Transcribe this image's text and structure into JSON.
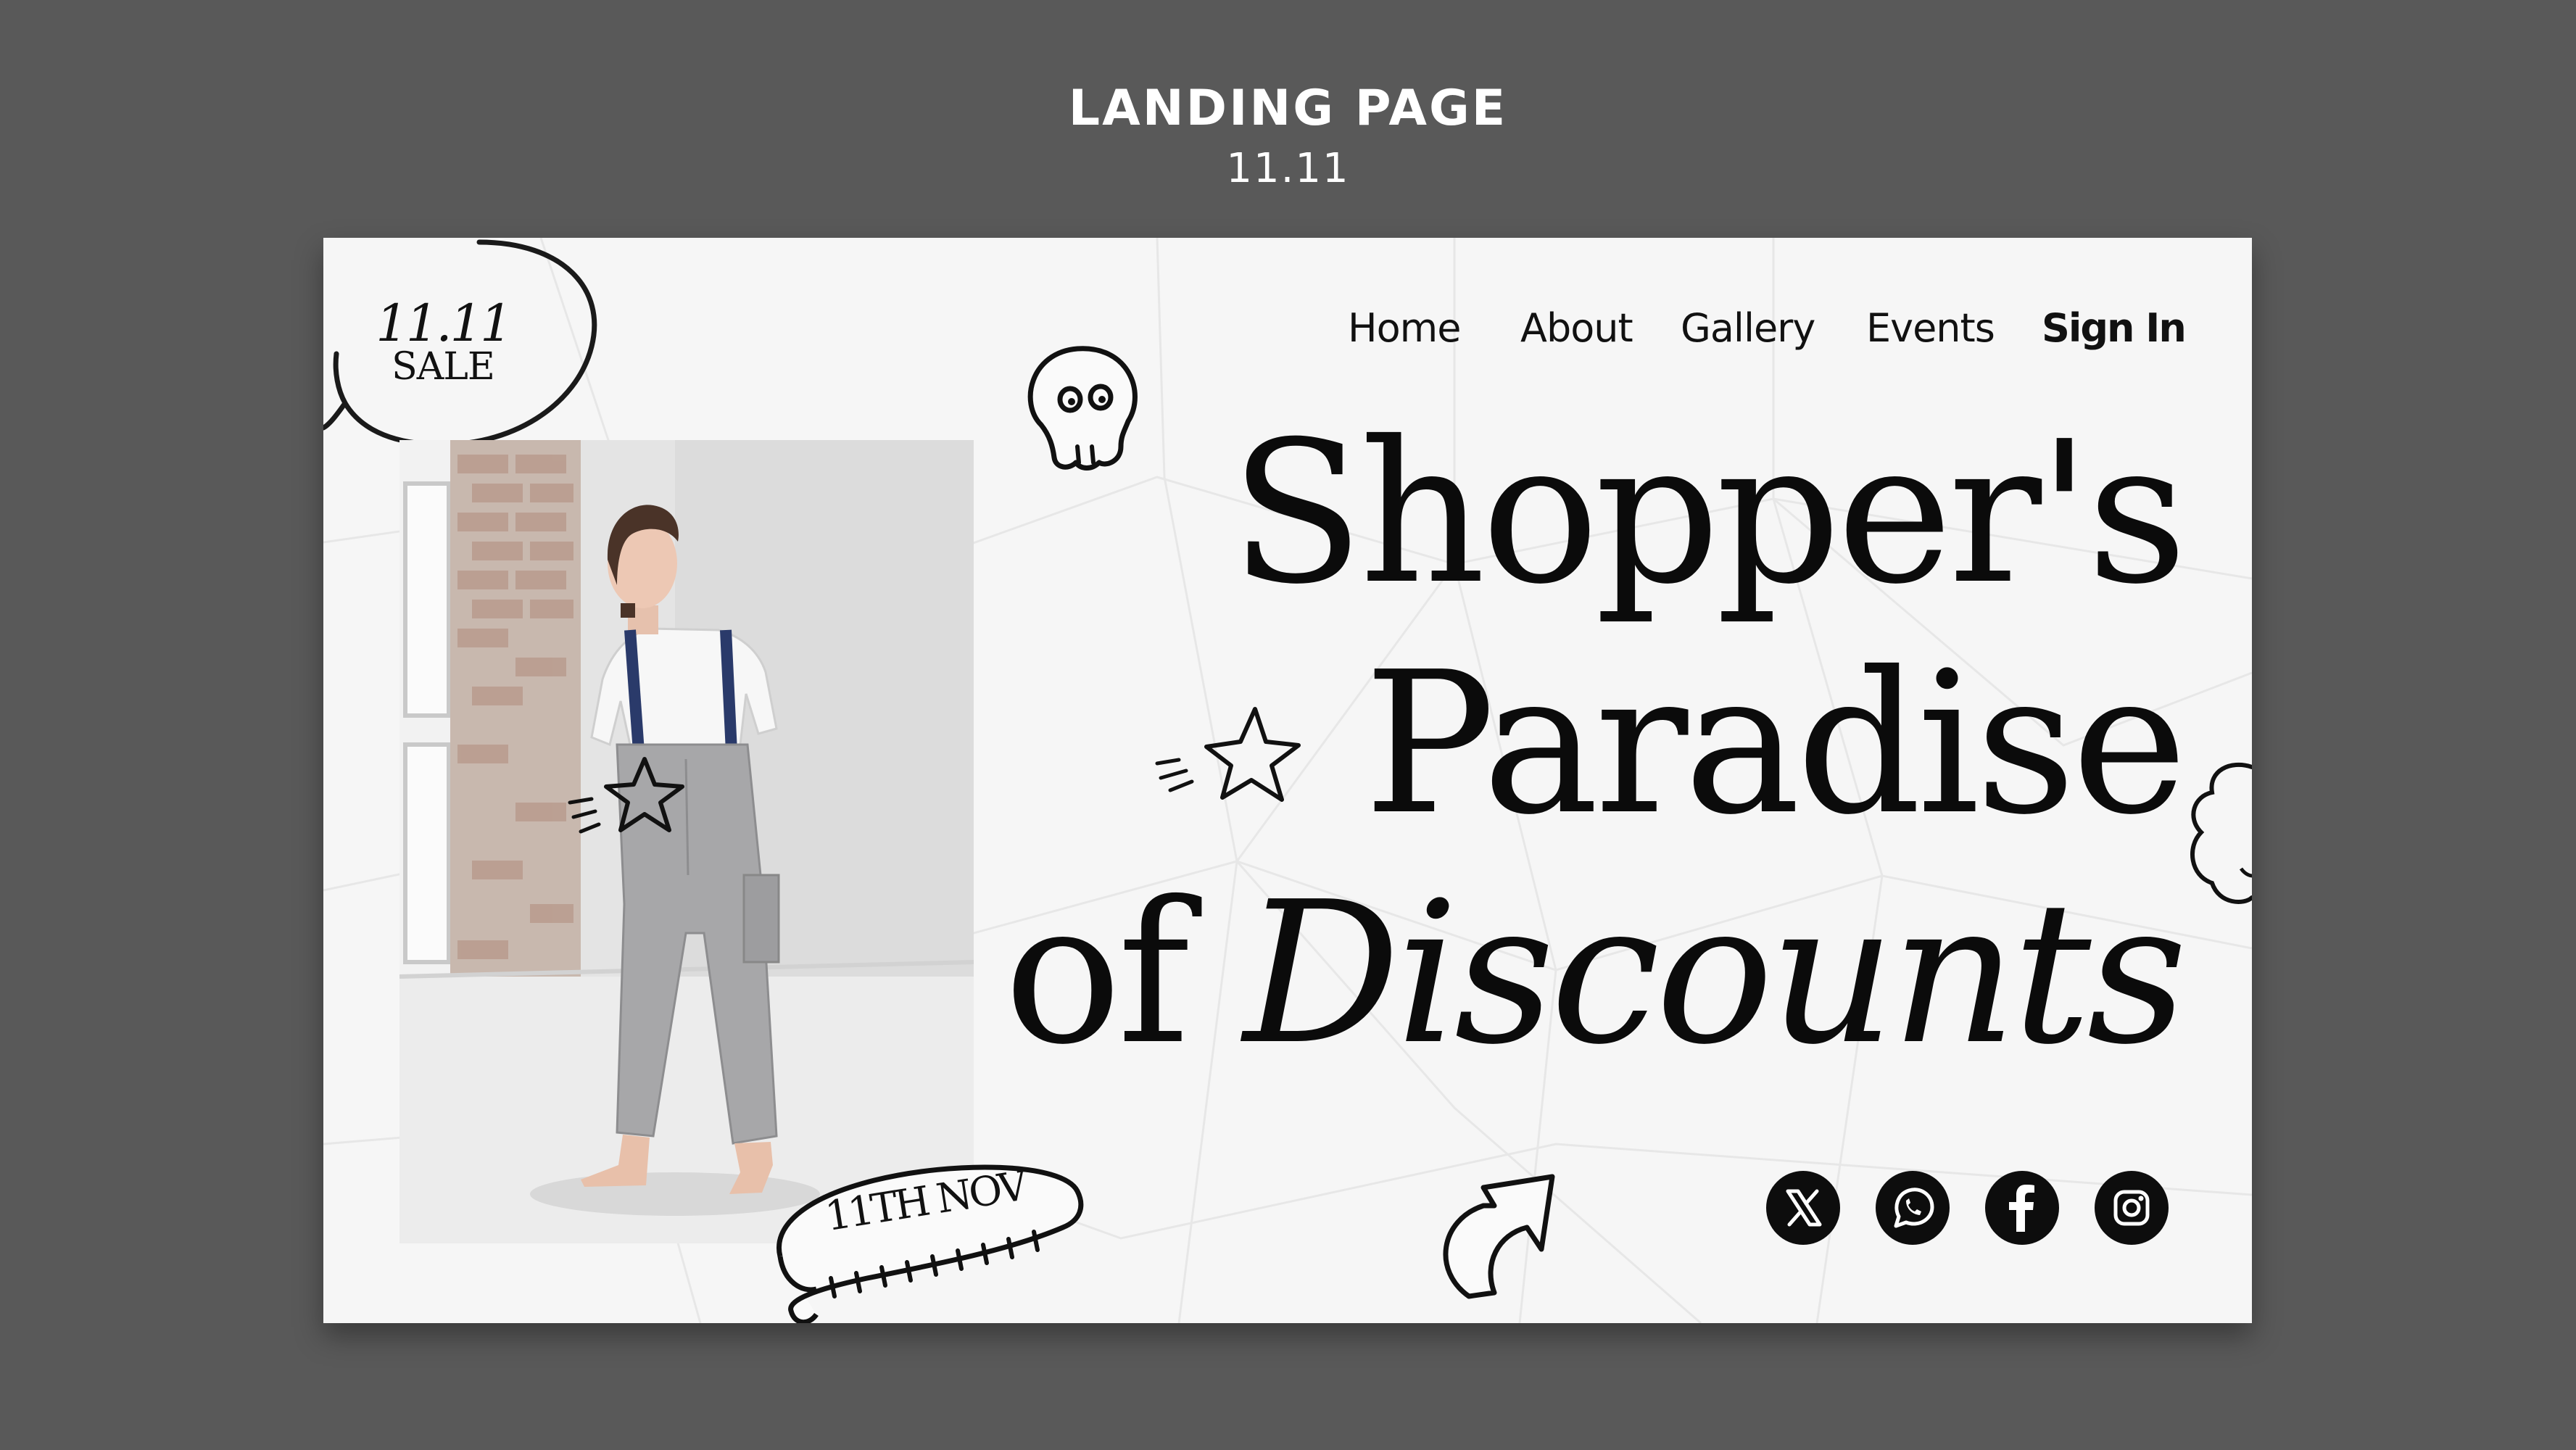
{
  "page_header": {
    "title": "LANDING PAGE",
    "subtitle": "11.11"
  },
  "badge": {
    "number": "11.11",
    "word": "SALE"
  },
  "nav": {
    "items": [
      {
        "label": "Home"
      },
      {
        "label": "About"
      },
      {
        "label": "Gallery"
      },
      {
        "label": "Events"
      }
    ],
    "signin_label": "Sign In"
  },
  "hero": {
    "line1": "Shopper's",
    "line2": "Paradise",
    "line3_plain": "of",
    "line3_italic": "Discounts"
  },
  "date_tag": {
    "text": "11TH NOV"
  },
  "social": [
    {
      "icon": "x-icon"
    },
    {
      "icon": "whatsapp-icon"
    },
    {
      "icon": "facebook-icon"
    },
    {
      "icon": "instagram-icon"
    }
  ],
  "colors": {
    "background": "#595959",
    "card": "#f6f6f6",
    "ink": "#0b0b0b",
    "icon_bg": "#0d0d0d",
    "icon_fg": "#ffffff"
  }
}
